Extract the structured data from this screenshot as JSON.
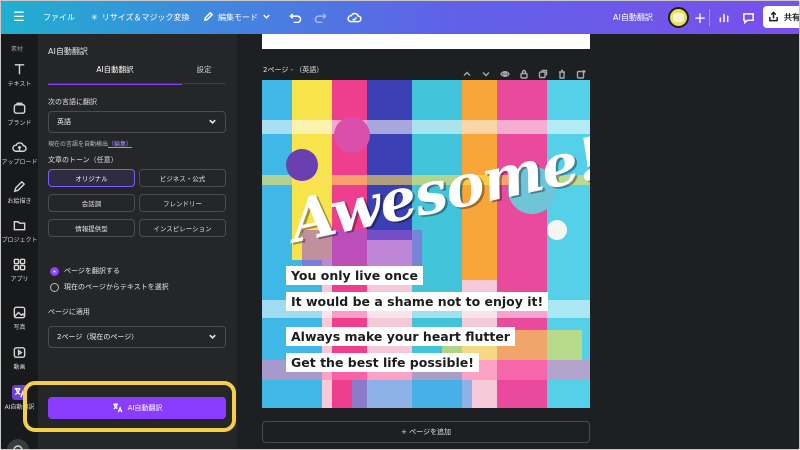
{
  "header": {
    "file_label": "ファイル",
    "resize_label": "リサイズ＆マジック変換",
    "edit_mode_label": "編集モード",
    "doc_title": "AI自動翻訳",
    "share_label": "共有"
  },
  "rail": {
    "title": "素材",
    "items": [
      {
        "label": "テキスト",
        "icon": "text-icon"
      },
      {
        "label": "ブランド",
        "icon": "brand-icon"
      },
      {
        "label": "アップロード",
        "icon": "upload-icon"
      },
      {
        "label": "お絵描き",
        "icon": "draw-icon"
      },
      {
        "label": "プロジェクト",
        "icon": "folder-icon"
      },
      {
        "label": "アプリ",
        "icon": "apps-icon"
      },
      {
        "label": "写真",
        "icon": "photo-icon"
      },
      {
        "label": "動画",
        "icon": "video-icon"
      },
      {
        "label": "AI自動翻訳",
        "icon": "translate-icon"
      }
    ]
  },
  "panel": {
    "title": "AI自動翻訳",
    "tabs": [
      "AI自動翻訳",
      "設定"
    ],
    "translate_to_label": "次の言語に翻訳",
    "language_value": "英語",
    "auto_detect_text": "現在の言語を自動検出",
    "auto_detect_link": "（編集）",
    "tone_label": "文章のトーン（任意）",
    "tones": [
      "オリジナル",
      "ビジネス・公式",
      "会話調",
      "フレンドリー",
      "情報提供型",
      "インスピレーション"
    ],
    "selected_tone": "オリジナル",
    "scope_options": [
      "ページを翻訳する",
      "現在のページからテキストを選択"
    ],
    "apply_label": "ページに適用",
    "apply_value": "2ページ（現在のページ）",
    "translate_button": "AI自動翻訳"
  },
  "canvas": {
    "page_label": "2ページ - （英語）",
    "add_page": "+ ページを追加",
    "headline": "Awesome!",
    "captions": [
      "You only live once",
      "It would be a shame not to enjoy it!",
      "Always make your heart flutter",
      "Get the best life possible!"
    ]
  },
  "colors": {
    "accent": "#8b3dff",
    "highlight": "#f4cf49",
    "panel_bg": "#252628"
  }
}
